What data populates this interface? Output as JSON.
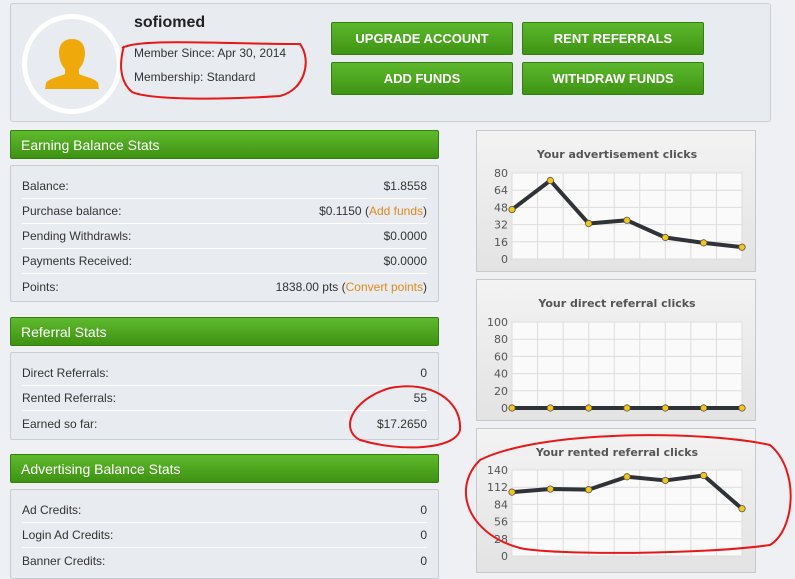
{
  "profile": {
    "username": "sofiomed",
    "member_since": "Member Since: Apr 30, 2014",
    "membership": "Membership: Standard",
    "avatar_color": "#f0a90b"
  },
  "buttons": {
    "upgrade": "UPGRADE ACCOUNT",
    "rent": "RENT REFERRALS",
    "add_funds": "ADD FUNDS",
    "withdraw": "WITHDRAW FUNDS"
  },
  "earning": {
    "title": "Earning Balance Stats",
    "rows": [
      {
        "label": "Balance:",
        "value": "$1.8558"
      },
      {
        "label": "Purchase balance:",
        "value": "$0.1150",
        "link": "Add funds"
      },
      {
        "label": "Pending Withdrawls:",
        "value": "$0.0000"
      },
      {
        "label": "Payments Received:",
        "value": "$0.0000"
      },
      {
        "label": "Points:",
        "value": "1838.00 pts",
        "link": "Convert points"
      }
    ]
  },
  "referral": {
    "title": "Referral Stats",
    "rows": [
      {
        "label": "Direct Referrals:",
        "value": "0"
      },
      {
        "label": "Rented Referrals:",
        "value": "55"
      },
      {
        "label": "Earned so far:",
        "value": "$17.2650"
      }
    ]
  },
  "advertising": {
    "title": "Advertising Balance Stats",
    "rows": [
      {
        "label": "Ad Credits:",
        "value": "0"
      },
      {
        "label": "Login Ad Credits:",
        "value": "0"
      },
      {
        "label": "Banner Credits:",
        "value": "0"
      }
    ]
  },
  "chart_data": [
    {
      "type": "line",
      "title": "Your advertisement clicks",
      "ylim": [
        0,
        80
      ],
      "yticks": [
        0,
        16,
        32,
        48,
        64,
        80
      ],
      "values": [
        46,
        73,
        33,
        36,
        20,
        15,
        11
      ],
      "grid": true
    },
    {
      "type": "line",
      "title": "Your direct referral clicks",
      "ylim": [
        0,
        100
      ],
      "yticks": [
        0,
        20,
        40,
        60,
        80,
        100
      ],
      "values": [
        0,
        0,
        0,
        0,
        0,
        0,
        0
      ],
      "grid": true
    },
    {
      "type": "line",
      "title": "Your rented referral clicks",
      "ylim": [
        0,
        140
      ],
      "yticks": [
        0,
        28,
        56,
        84,
        112,
        140
      ],
      "values": [
        104,
        109,
        108,
        129,
        123,
        131,
        77
      ],
      "grid": true
    }
  ],
  "colors": {
    "accent": "#4aa31d",
    "line": "#2f3338",
    "marker": "#f5c518",
    "link": "#e08a1e",
    "annotation": "#e81818"
  }
}
